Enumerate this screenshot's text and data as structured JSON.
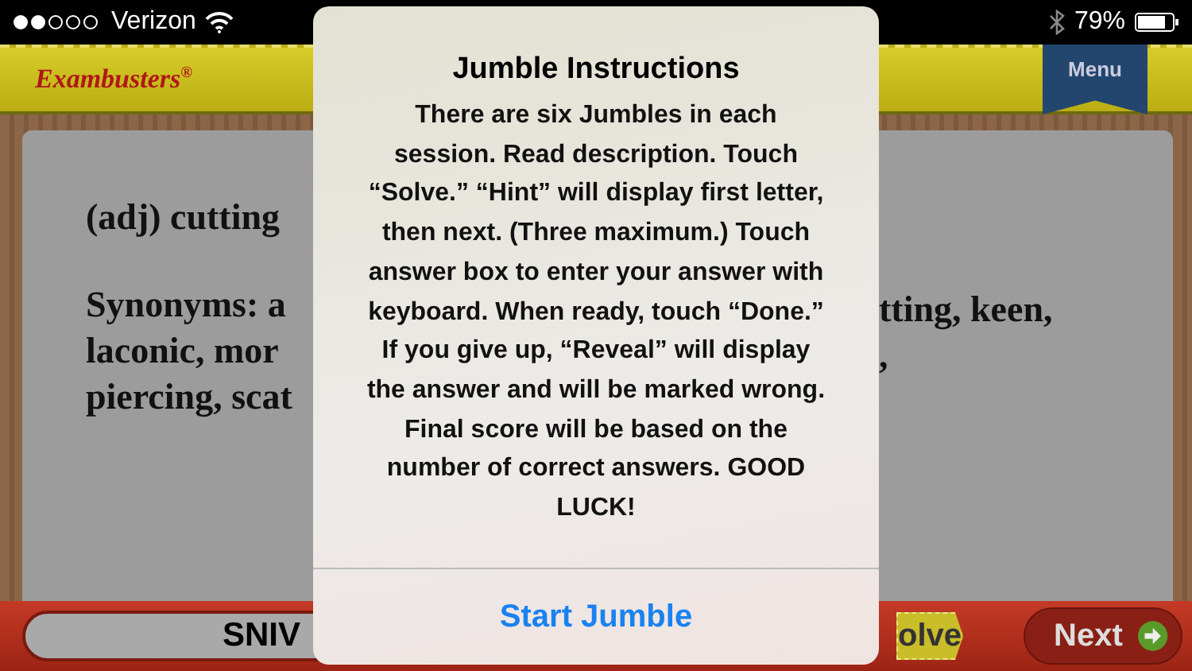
{
  "status_bar": {
    "carrier": "Verizon",
    "battery": "79%"
  },
  "header": {
    "logo": "Exambusters$^{®}$",
    "menu_button": "Menu"
  },
  "card": {
    "left_lines": [
      "(adj) cutting",
      "Synonyms: a",
      "laconic, mor",
      "piercing, scat"
    ],
    "right_lines": [
      "tting, keen,",
      ","
    ]
  },
  "bottom_bar": {
    "answer_field": "SNIV",
    "solve_button": "olve",
    "next_button": "Next"
  },
  "dialog": {
    "title": "Jumble Instructions",
    "message": "There are six Jumbles in each session. Read description. Touch “Solve.” “Hint” will display first letter, then next. (Three maximum.) Touch answer box to enter your answer with keyboard. When ready, touch “Done.” If you give up, “Reveal” will display the answer and will be marked wrong. Final score will be based on the number of correct answers. GOOD LUCK!",
    "button": "Start Jumble"
  }
}
